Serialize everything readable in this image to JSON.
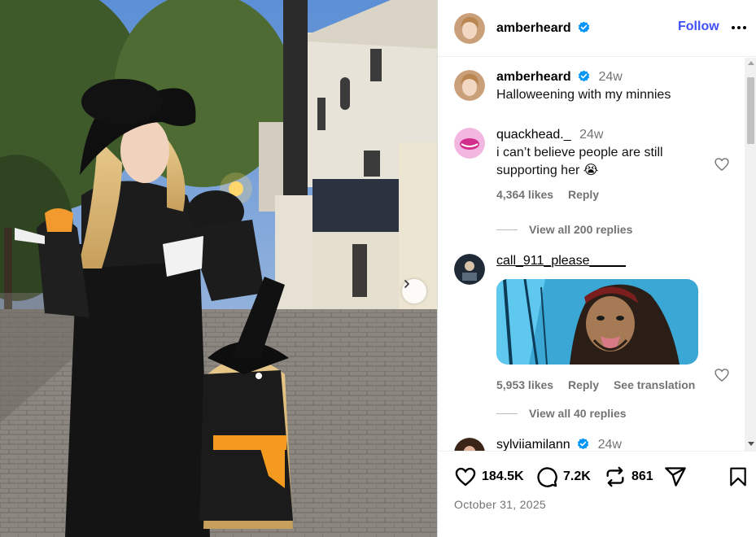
{
  "post": {
    "username": "amberheard",
    "follow_label": "Follow",
    "caption": "Halloweening with my minnies",
    "caption_time": "24w",
    "date": "October 31, 2025"
  },
  "comments": [
    {
      "username": "quackhead._",
      "time": "24w",
      "text_line1": "i can’t believe people are still",
      "text_line2": "supporting her 😭",
      "likes": "4,364 likes",
      "reply_label": "Reply",
      "view_replies": "View all 200 replies"
    },
    {
      "username": "call_911_please_____",
      "likes": "5,953 likes",
      "reply_label": "Reply",
      "translate_label": "See translation",
      "view_replies": "View all 40 replies"
    },
    {
      "username": "sylviiamilann",
      "time": "24w"
    }
  ],
  "actions": {
    "likes_count": "184.5K",
    "comments_count": "7.2K",
    "reposts_count": "861"
  },
  "icons": {
    "verified": "verified-badge-icon",
    "more": "more-horizontal-icon",
    "like": "heart-icon",
    "comment": "comment-bubble-icon",
    "repost": "repost-icon",
    "share": "send-icon",
    "save": "bookmark-icon",
    "next": "chevron-right-icon"
  },
  "colors": {
    "accent": "#4150f7",
    "verified": "#0095f6",
    "muted": "#737373"
  }
}
